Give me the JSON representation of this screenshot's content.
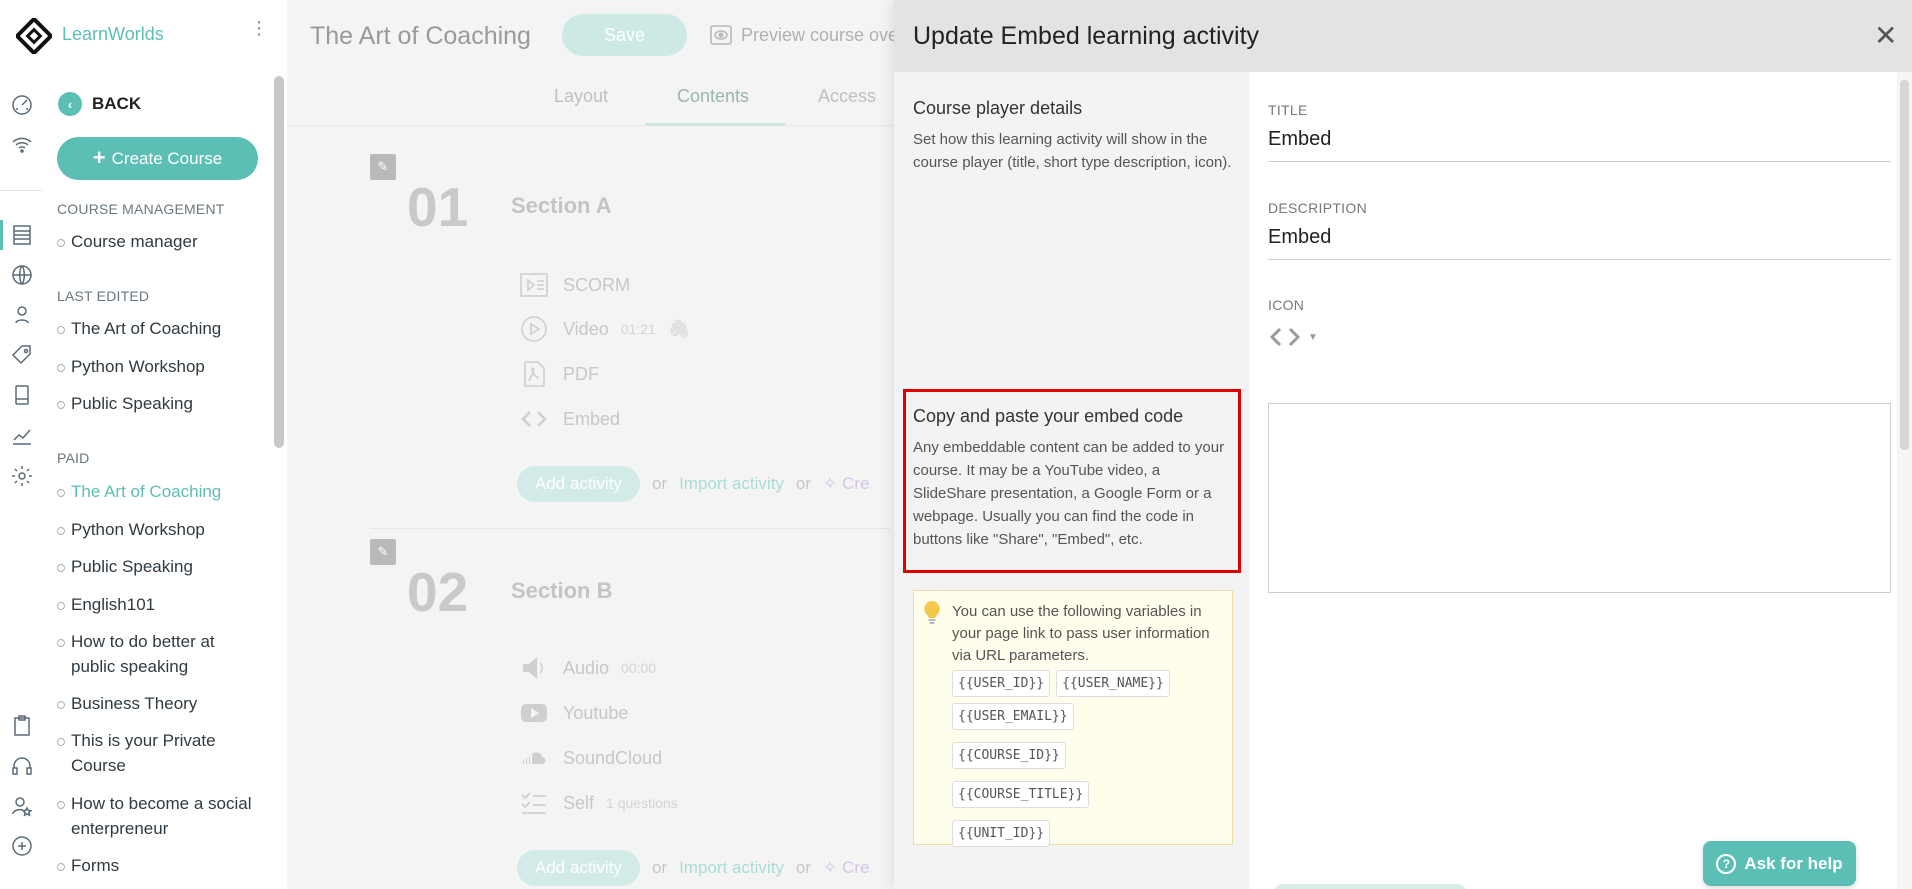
{
  "brand": {
    "name": "LearnWorlds"
  },
  "rail": {
    "icons": [
      "speedometer-icon",
      "broadcast-icon",
      "courses-icon",
      "globe-icon",
      "user-pin-icon",
      "tag-icon",
      "mobile-icon",
      "analytics-icon",
      "settings-icon",
      "clipboard-icon",
      "headset-icon",
      "user-star-icon",
      "add-circle-icon"
    ]
  },
  "nav": {
    "back_label": "BACK",
    "create_label": "Create Course",
    "course_management_heading": "COURSE MANAGEMENT",
    "course_manager": "Course manager",
    "last_edited_heading": "LAST EDITED",
    "last_edited": [
      "The Art of Coaching",
      "Python Workshop",
      "Public Speaking"
    ],
    "paid_heading": "PAID",
    "paid": [
      "The Art of Coaching",
      "Python Workshop",
      "Public Speaking",
      "English101",
      "How to do better at public speaking",
      "Business Theory",
      "This is your Private Course",
      "How to become a social enterpreneur",
      "Forms"
    ]
  },
  "editor": {
    "course_title": "The Art of Coaching",
    "save_label": "Save",
    "preview_label": "Preview course ove",
    "tabs": [
      "Layout",
      "Contents",
      "Access"
    ],
    "active_tab": "Contents",
    "sections": [
      {
        "number": "01",
        "title": "Section A",
        "activities": [
          {
            "label": "SCORM",
            "meta": "",
            "icon": "scorm-icon"
          },
          {
            "label": "Video",
            "meta": "01:21",
            "icon": "video-icon"
          },
          {
            "label": "PDF",
            "meta": "",
            "icon": "pdf-icon"
          },
          {
            "label": "Embed",
            "meta": "",
            "icon": "embed-code-icon"
          }
        ]
      },
      {
        "number": "02",
        "title": "Section B",
        "activities": [
          {
            "label": "Audio",
            "meta": "00:00",
            "icon": "audio-icon"
          },
          {
            "label": "Youtube",
            "meta": "",
            "icon": "youtube-icon"
          },
          {
            "label": "SoundCloud",
            "meta": "",
            "icon": "soundcloud-icon"
          },
          {
            "label": "Self",
            "meta": "1 questions",
            "icon": "checklist-icon"
          }
        ]
      }
    ],
    "add_activity": "Add activity",
    "or": "or",
    "import_activity": "Import activity",
    "create_partial": "Cre"
  },
  "panel": {
    "title": "Update Embed learning activity",
    "player_details_heading": "Course player details",
    "player_details_text": "Set how this learning activity will show in the course player (title, short type description, icon).",
    "embed_heading": "Copy and paste your embed code",
    "embed_text": "Any embeddable content can be added to your course. It may be a YouTube video, a SlideShare presentation, a Google Form or a webpage. Usually you can find the code in buttons like \"Share\", \"Embed\", etc.",
    "tip_text": "You can use the following variables in your page link to pass user information via URL parameters.",
    "variables": [
      "{{USER_ID}}",
      "{{USER_NAME}}",
      "{{USER_EMAIL}}",
      "{{COURSE_ID}}",
      "{{COURSE_TITLE}}",
      "{{UNIT_ID}}"
    ],
    "title_label": "TITLE",
    "title_value": "Embed",
    "description_label": "DESCRIPTION",
    "description_value": "Embed",
    "icon_label": "ICON",
    "embed_code_value": ""
  },
  "help": {
    "label": "Ask for help"
  },
  "colors": {
    "accent": "#5bbfb5",
    "highlight": "#e00000",
    "tip_bg": "#fffdec"
  }
}
